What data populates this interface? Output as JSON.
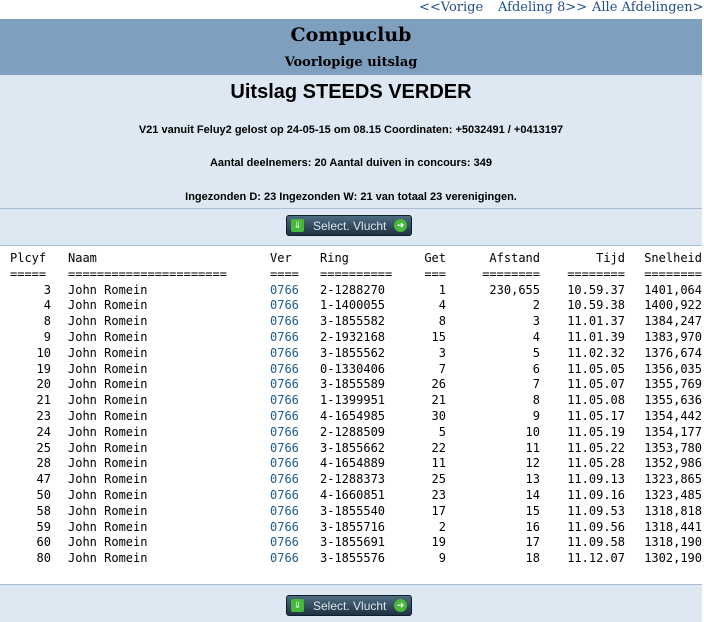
{
  "nav": {
    "prev": "<<Vorige",
    "section": "Afdeling 8>>",
    "all": "Alle Afdelingen>>"
  },
  "header": {
    "club": "Compuclub",
    "subtitle": "Voorlopige uitslag",
    "race_title": "Uitslag STEEDS VERDER",
    "line1": "V21 vanuit Feluy2 gelost op 24-05-15 om 08.15 Coordinaten: +5032491 / +0413197",
    "line2": "Aantal deelnemers: 20 Aantal duiven in concours: 349",
    "line3": "Ingezonden D: 23 Ingezonden W: 21 van totaal 23 verenigingen."
  },
  "buttons": {
    "select_top": "Select. Vlucht",
    "select_bottom": "Select. Vlucht"
  },
  "table": {
    "headers": {
      "plcyf": "Plcyf",
      "naam": "Naam",
      "ver": "Ver",
      "ring": "Ring",
      "get": "Get",
      "afstand": "Afstand",
      "tijd": "Tijd",
      "snelheid": "Snelheid"
    },
    "underline": {
      "plcyf": "=====",
      "naam": "======================",
      "ver": "====",
      "ring": "==========",
      "get": "===",
      "afstand": "========",
      "tijd": "========",
      "snelheid": "========"
    },
    "rows": [
      {
        "plcyf": "3",
        "naam": "John Romein",
        "ver": "0766",
        "ring": "2-1288270",
        "get": "1",
        "afstand": "230,655",
        "tijd": "10.59.37",
        "snelheid": "1401,064"
      },
      {
        "plcyf": "4",
        "naam": "John Romein",
        "ver": "0766",
        "ring": "1-1400055",
        "get": "4",
        "afstand": "2",
        "tijd": "10.59.38",
        "snelheid": "1400,922"
      },
      {
        "plcyf": "8",
        "naam": "John Romein",
        "ver": "0766",
        "ring": "3-1855582",
        "get": "8",
        "afstand": "3",
        "tijd": "11.01.37",
        "snelheid": "1384,247"
      },
      {
        "plcyf": "9",
        "naam": "John Romein",
        "ver": "0766",
        "ring": "2-1932168",
        "get": "15",
        "afstand": "4",
        "tijd": "11.01.39",
        "snelheid": "1383,970"
      },
      {
        "plcyf": "10",
        "naam": "John Romein",
        "ver": "0766",
        "ring": "3-1855562",
        "get": "3",
        "afstand": "5",
        "tijd": "11.02.32",
        "snelheid": "1376,674"
      },
      {
        "plcyf": "19",
        "naam": "John Romein",
        "ver": "0766",
        "ring": "0-1330406",
        "get": "7",
        "afstand": "6",
        "tijd": "11.05.05",
        "snelheid": "1356,035"
      },
      {
        "plcyf": "20",
        "naam": "John Romein",
        "ver": "0766",
        "ring": "3-1855589",
        "get": "26",
        "afstand": "7",
        "tijd": "11.05.07",
        "snelheid": "1355,769"
      },
      {
        "plcyf": "21",
        "naam": "John Romein",
        "ver": "0766",
        "ring": "1-1399951",
        "get": "21",
        "afstand": "8",
        "tijd": "11.05.08",
        "snelheid": "1355,636"
      },
      {
        "plcyf": "23",
        "naam": "John Romein",
        "ver": "0766",
        "ring": "4-1654985",
        "get": "30",
        "afstand": "9",
        "tijd": "11.05.17",
        "snelheid": "1354,442"
      },
      {
        "plcyf": "24",
        "naam": "John Romein",
        "ver": "0766",
        "ring": "2-1288509",
        "get": "5",
        "afstand": "10",
        "tijd": "11.05.19",
        "snelheid": "1354,177"
      },
      {
        "plcyf": "25",
        "naam": "John Romein",
        "ver": "0766",
        "ring": "3-1855662",
        "get": "22",
        "afstand": "11",
        "tijd": "11.05.22",
        "snelheid": "1353,780"
      },
      {
        "plcyf": "28",
        "naam": "John Romein",
        "ver": "0766",
        "ring": "4-1654889",
        "get": "11",
        "afstand": "12",
        "tijd": "11.05.28",
        "snelheid": "1352,986"
      },
      {
        "plcyf": "47",
        "naam": "John Romein",
        "ver": "0766",
        "ring": "2-1288373",
        "get": "25",
        "afstand": "13",
        "tijd": "11.09.13",
        "snelheid": "1323,865"
      },
      {
        "plcyf": "50",
        "naam": "John Romein",
        "ver": "0766",
        "ring": "4-1660851",
        "get": "23",
        "afstand": "14",
        "tijd": "11.09.16",
        "snelheid": "1323,485"
      },
      {
        "plcyf": "58",
        "naam": "John Romein",
        "ver": "0766",
        "ring": "3-1855540",
        "get": "17",
        "afstand": "15",
        "tijd": "11.09.53",
        "snelheid": "1318,818"
      },
      {
        "plcyf": "59",
        "naam": "John Romein",
        "ver": "0766",
        "ring": "3-1855716",
        "get": "2",
        "afstand": "16",
        "tijd": "11.09.56",
        "snelheid": "1318,441"
      },
      {
        "plcyf": "60",
        "naam": "John Romein",
        "ver": "0766",
        "ring": "3-1855691",
        "get": "19",
        "afstand": "17",
        "tijd": "11.09.58",
        "snelheid": "1318,190"
      },
      {
        "plcyf": "80",
        "naam": "John Romein",
        "ver": "0766",
        "ring": "3-1855576",
        "get": "9",
        "afstand": "18",
        "tijd": "11.12.07",
        "snelheid": "1302,190"
      }
    ]
  }
}
